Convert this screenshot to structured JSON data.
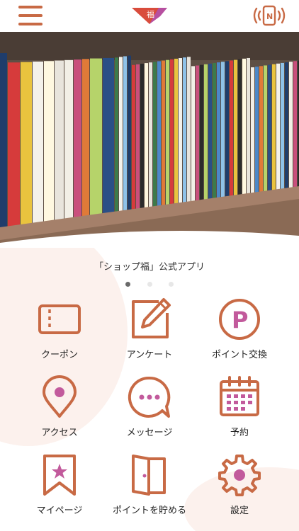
{
  "header": {
    "menu_icon": "hamburger-menu-icon",
    "logo_text": "福",
    "nfc_icon": "nfc-phone-icon",
    "nfc_letter": "N"
  },
  "carousel": {
    "caption": "「ショップ福」公式アプリ",
    "slide_count": 3,
    "active_index": 0
  },
  "menu": {
    "items": [
      {
        "label": "クーポン",
        "icon": "coupon-icon"
      },
      {
        "label": "アンケート",
        "icon": "survey-icon"
      },
      {
        "label": "ポイント交換",
        "icon": "point-exchange-icon"
      },
      {
        "label": "アクセス",
        "icon": "map-pin-icon"
      },
      {
        "label": "メッセージ",
        "icon": "message-icon"
      },
      {
        "label": "予約",
        "icon": "calendar-icon"
      },
      {
        "label": "マイページ",
        "icon": "bookmark-star-icon"
      },
      {
        "label": "ポイントを貯める",
        "icon": "door-icon"
      },
      {
        "label": "設定",
        "icon": "gear-icon"
      }
    ]
  },
  "colors": {
    "accent": "#c86a45",
    "logo_red": "#d94c3c",
    "logo_purple": "#b64fa0",
    "point_p": "#c25a9c",
    "background_blob": "#fbf0ec"
  }
}
